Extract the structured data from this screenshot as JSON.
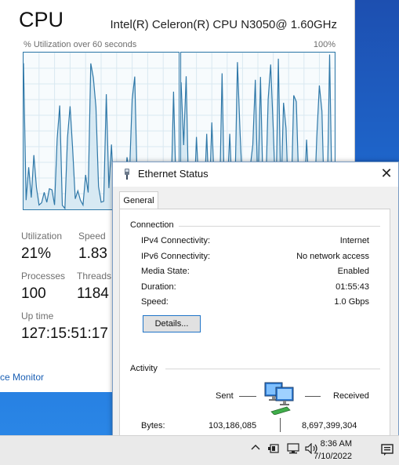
{
  "task_manager": {
    "title": "CPU",
    "cpu_name": "Intel(R) Celeron(R) CPU N3050@ 1.60GHz",
    "graph_label": "% Utilization over 60 seconds",
    "graph_max": "100%",
    "stats": {
      "utilization_label": "Utilization",
      "utilization_value": "21%",
      "speed_label": "Speed",
      "speed_value": "1.83",
      "processes_label": "Processes",
      "processes_value": "100",
      "threads_label": "Threads",
      "threads_value": "1184",
      "uptime_label": "Up time",
      "uptime_value": "127:15:51:17"
    },
    "resource_monitor_link": "ce Monitor"
  },
  "ethernet_dialog": {
    "title": "Ethernet Status",
    "close_glyph": "✕",
    "tab_general": "General",
    "connection": {
      "group_label": "Connection",
      "rows": [
        {
          "label": "IPv4 Connectivity:",
          "value": "Internet"
        },
        {
          "label": "IPv6 Connectivity:",
          "value": "No network access"
        },
        {
          "label": "Media State:",
          "value": "Enabled"
        },
        {
          "label": "Duration:",
          "value": "01:55:43"
        },
        {
          "label": "Speed:",
          "value": "1.0 Gbps"
        }
      ],
      "details_button": "Details..."
    },
    "activity": {
      "group_label": "Activity",
      "sent_label": "Sent",
      "received_label": "Received",
      "bytes_label": "Bytes:",
      "bytes_sent": "103,186,085",
      "bytes_received": "8,697,399,304",
      "icon": "network-computers-icon"
    }
  },
  "taskbar": {
    "time": "8:36 AM",
    "date": "7/10/2022",
    "tray_icons": [
      "chevron-up-icon",
      "battery-icon",
      "network-icon",
      "volume-icon",
      "notifications-icon"
    ]
  },
  "colors": {
    "graph_line": "#2f78a8",
    "graph_fill": "#d7e9f3",
    "link": "#1a5fb4",
    "desktop": "#1f6fd6"
  }
}
